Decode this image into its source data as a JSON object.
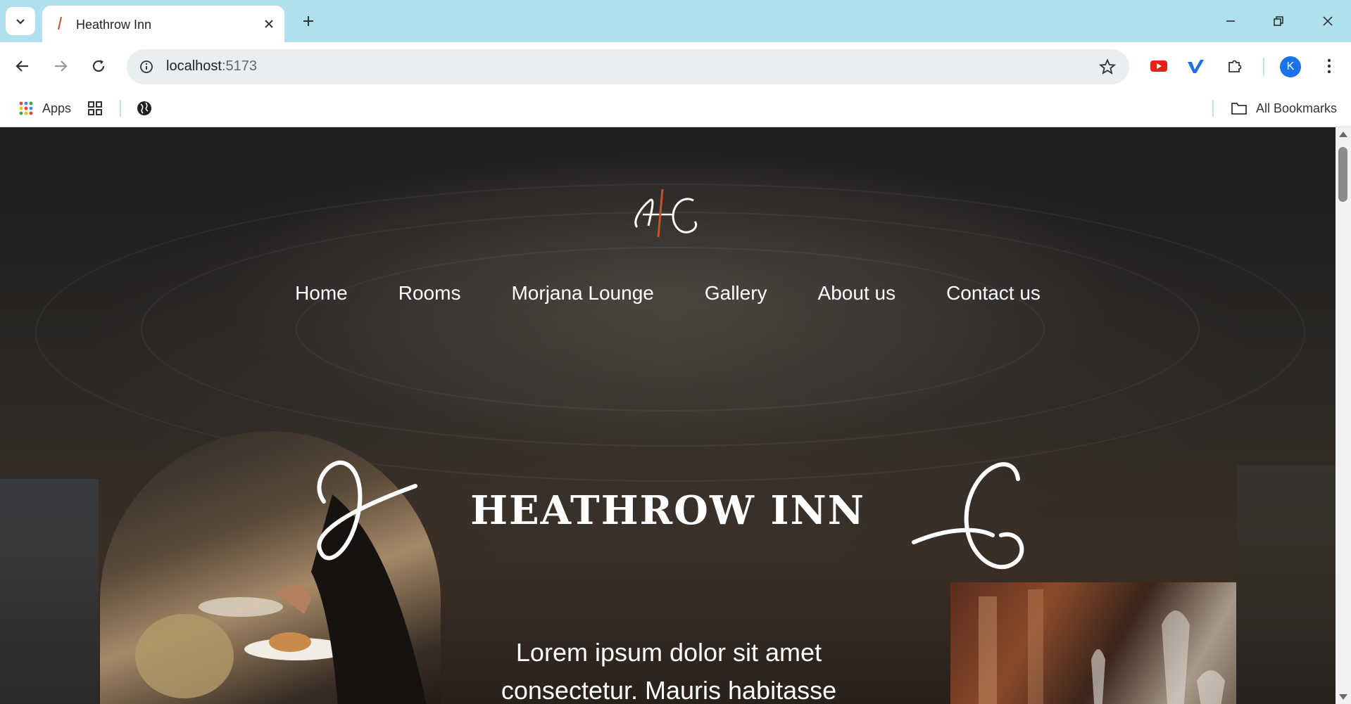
{
  "browser": {
    "tab_title": "Heathrow Inn",
    "url_host": "localhost",
    "url_port": ":5173",
    "bookmarks": {
      "apps_label": "Apps",
      "all_bookmarks_label": "All Bookmarks"
    },
    "profile_initial": "K"
  },
  "site": {
    "nav": [
      "Home",
      "Rooms",
      "Morjana Lounge",
      "Gallery",
      "About us",
      "Contact us"
    ],
    "hero_title": "HEATHROW INN",
    "hero_subtitle_line1": "Lorem ipsum dolor sit amet",
    "hero_subtitle_line2": "consectetur. Mauris habitasse",
    "accent_color": "#c5532a"
  }
}
